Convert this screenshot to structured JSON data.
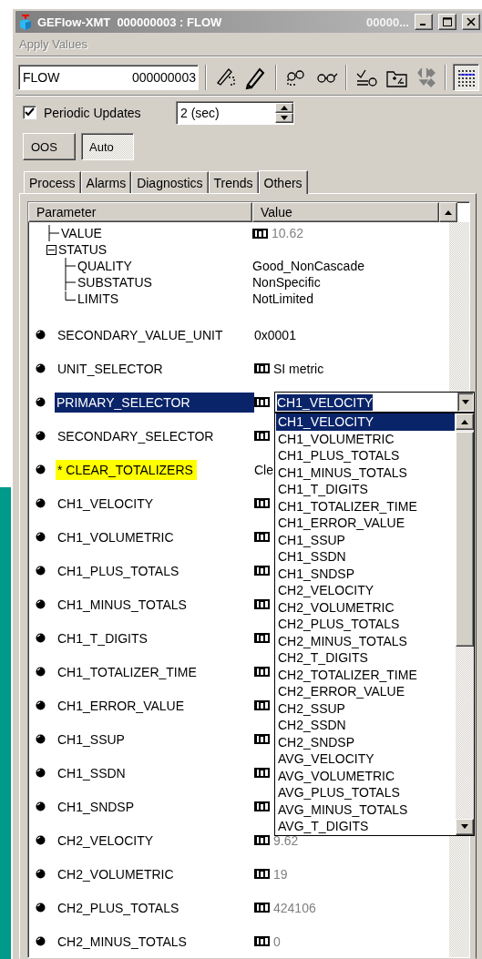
{
  "window": {
    "title": "GEFlow-XMT  000000003 : FLOW",
    "title_extra": "00000..."
  },
  "menu": [
    {
      "label": "Apply Values",
      "disabled": true
    }
  ],
  "toolbar": {
    "tag": "FLOW",
    "id": "000000003",
    "groups": [
      {
        "buttons": [
          {
            "kind": "pen-dashed",
            "disabled": false,
            "selected": false
          },
          {
            "kind": "pencil",
            "disabled": false,
            "selected": false
          }
        ]
      },
      {
        "buttons": [
          {
            "kind": "glasses-dashed",
            "disabled": false,
            "selected": false
          },
          {
            "kind": "glasses",
            "disabled": false,
            "selected": false
          }
        ]
      },
      {
        "buttons": [
          {
            "kind": "checklist",
            "disabled": false,
            "selected": false
          },
          {
            "kind": "folder",
            "disabled": false,
            "selected": false
          },
          {
            "kind": "diamonds",
            "disabled": true,
            "selected": false
          }
        ]
      },
      {
        "buttons": [
          {
            "kind": "lines",
            "disabled": false,
            "selected": true
          }
        ]
      }
    ]
  },
  "periodic": {
    "label": "Periodic Updates",
    "checked": true,
    "interval": "2 (sec)"
  },
  "modes": [
    {
      "label": "OOS",
      "selected": false
    },
    {
      "label": "Auto",
      "selected": true
    }
  ],
  "tabs": [
    {
      "label": "Process",
      "selected": false
    },
    {
      "label": "Alarms",
      "selected": false
    },
    {
      "label": "Diagnostics",
      "selected": false
    },
    {
      "label": "Trends",
      "selected": false
    },
    {
      "label": "Others",
      "selected": true
    }
  ],
  "table": {
    "columns": [
      "Parameter",
      "Value"
    ],
    "tree": [
      {
        "label": "VALUE",
        "value": "10.62",
        "icon": true,
        "muted": true
      },
      {
        "label": "STATUS",
        "expanded": true,
        "children": [
          {
            "label": "QUALITY",
            "value": "Good_NonCascade"
          },
          {
            "label": "SUBSTATUS",
            "value": "NonSpecific"
          },
          {
            "label": "LIMITS",
            "value": "NotLimited"
          }
        ]
      }
    ],
    "rows": [
      {
        "name": "SECONDARY_VALUE_UNIT",
        "value": "0x0001",
        "icon": false,
        "muted": false,
        "highlighted": false,
        "selected": false
      },
      {
        "name": "UNIT_SELECTOR",
        "value": "SI metric",
        "icon": true,
        "muted": false,
        "highlighted": false,
        "selected": false
      },
      {
        "name": "PRIMARY_SELECTOR",
        "icon": true,
        "highlighted": false,
        "selected": true,
        "editor": {
          "value": "CH1_VELOCITY",
          "expanded": true,
          "options": [
            {
              "label": "CH1_VELOCITY",
              "selected": true
            },
            {
              "label": "CH1_VOLUMETRIC",
              "selected": false
            },
            {
              "label": "CH1_PLUS_TOTALS",
              "selected": false
            },
            {
              "label": "CH1_MINUS_TOTALS",
              "selected": false
            },
            {
              "label": "CH1_T_DIGITS",
              "selected": false
            },
            {
              "label": "CH1_TOTALIZER_TIME",
              "selected": false
            },
            {
              "label": "CH1_ERROR_VALUE",
              "selected": false
            },
            {
              "label": "CH1_SSUP",
              "selected": false
            },
            {
              "label": "CH1_SSDN",
              "selected": false
            },
            {
              "label": "CH1_SNDSP",
              "selected": false
            },
            {
              "label": "CH2_VELOCITY",
              "selected": false
            },
            {
              "label": "CH2_VOLUMETRIC",
              "selected": false
            },
            {
              "label": "CH2_PLUS_TOTALS",
              "selected": false
            },
            {
              "label": "CH2_MINUS_TOTALS",
              "selected": false
            },
            {
              "label": "CH2_T_DIGITS",
              "selected": false
            },
            {
              "label": "CH2_TOTALIZER_TIME",
              "selected": false
            },
            {
              "label": "CH2_ERROR_VALUE",
              "selected": false
            },
            {
              "label": "CH2_SSUP",
              "selected": false
            },
            {
              "label": "CH2_SSDN",
              "selected": false
            },
            {
              "label": "CH2_SNDSP",
              "selected": false
            },
            {
              "label": "AVG_VELOCITY",
              "selected": false
            },
            {
              "label": "AVG_VOLUMETRIC",
              "selected": false
            },
            {
              "label": "AVG_PLUS_TOTALS",
              "selected": false
            },
            {
              "label": "AVG_MINUS_TOTALS",
              "selected": false
            },
            {
              "label": "AVG_T_DIGITS",
              "selected": false
            }
          ]
        }
      },
      {
        "name": "SECONDARY_SELECTOR",
        "icon": true,
        "highlighted": false,
        "selected": false
      },
      {
        "name": "* CLEAR_TOTALIZERS",
        "value": "Cle",
        "icon": false,
        "muted": false,
        "highlighted": true,
        "selected": false
      },
      {
        "name": "CH1_VELOCITY",
        "icon": true,
        "highlighted": false,
        "selected": false
      },
      {
        "name": "CH1_VOLUMETRIC",
        "icon": true,
        "highlighted": false,
        "selected": false
      },
      {
        "name": "CH1_PLUS_TOTALS",
        "icon": true,
        "highlighted": false,
        "selected": false
      },
      {
        "name": "CH1_MINUS_TOTALS",
        "icon": true,
        "highlighted": false,
        "selected": false
      },
      {
        "name": "CH1_T_DIGITS",
        "icon": true,
        "highlighted": false,
        "selected": false
      },
      {
        "name": "CH1_TOTALIZER_TIME",
        "icon": true,
        "highlighted": false,
        "selected": false
      },
      {
        "name": "CH1_ERROR_VALUE",
        "icon": true,
        "highlighted": false,
        "selected": false
      },
      {
        "name": "CH1_SSUP",
        "icon": true,
        "highlighted": false,
        "selected": false
      },
      {
        "name": "CH1_SSDN",
        "icon": true,
        "highlighted": false,
        "selected": false
      },
      {
        "name": "CH1_SNDSP",
        "icon": true,
        "highlighted": false,
        "selected": false
      },
      {
        "name": "CH2_VELOCITY",
        "value": "9.62",
        "icon": true,
        "muted": true,
        "highlighted": false,
        "selected": false
      },
      {
        "name": "CH2_VOLUMETRIC",
        "value": "19",
        "icon": true,
        "muted": true,
        "highlighted": false,
        "selected": false
      },
      {
        "name": "CH2_PLUS_TOTALS",
        "value": "424106",
        "icon": true,
        "muted": true,
        "highlighted": false,
        "selected": false
      },
      {
        "name": "CH2_MINUS_TOTALS",
        "value": "0",
        "icon": true,
        "muted": true,
        "highlighted": false,
        "selected": false
      }
    ]
  }
}
